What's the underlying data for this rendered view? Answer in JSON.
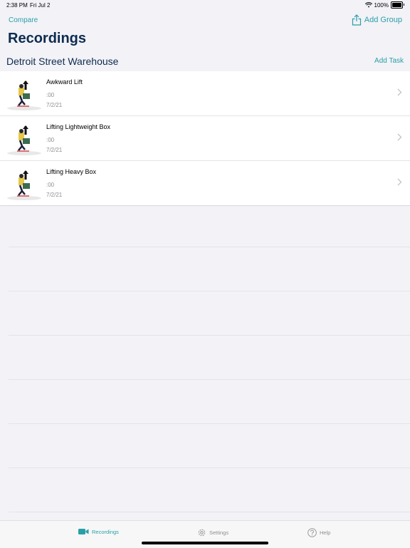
{
  "status_bar": {
    "time": "2:38 PM",
    "date": "Fri Jul 2",
    "battery": "100%",
    "wifi_icon": "wifi-icon",
    "battery_icon": "battery-icon"
  },
  "nav": {
    "compare_label": "Compare",
    "add_group_label": "Add Group",
    "share_icon": "share-icon",
    "accent_color": "#2a9fa8"
  },
  "page": {
    "title": "Recordings",
    "title_color": "#0d2c4f"
  },
  "group": {
    "name": "Detroit Street Warehouse",
    "add_task_label": "Add Task"
  },
  "recordings": [
    {
      "title": "Awkward Lift",
      "duration": ":00",
      "date": "7/2/21"
    },
    {
      "title": "Lifting Lightweight Box",
      "duration": ":00",
      "date": "7/2/21"
    },
    {
      "title": "Lifting Heavy Box",
      "duration": ":00",
      "date": "7/2/21"
    }
  ],
  "tab_bar": {
    "tabs": [
      {
        "label": "Recordings",
        "icon": "video-camera-icon",
        "active": true
      },
      {
        "label": "Settings",
        "icon": "gear-icon",
        "active": false
      },
      {
        "label": "Help",
        "icon": "question-mark-icon",
        "active": false
      }
    ]
  }
}
